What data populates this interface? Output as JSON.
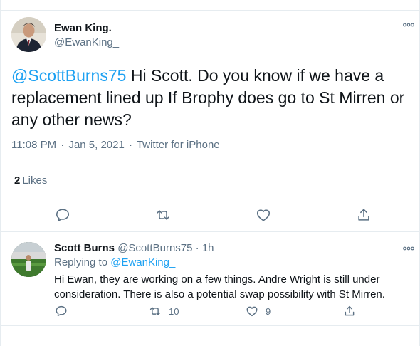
{
  "tweet": {
    "author_name": "Ewan King.",
    "author_handle": "@EwanKing_",
    "mention": "@ScottBurns75",
    "text": " Hi Scott. Do you know if we have a replacement lined up If Brophy does go to St Mirren or any other news?",
    "time": "11:08 PM",
    "date": "Jan 5, 2021",
    "source": "Twitter for iPhone",
    "likes_count": "2",
    "likes_label": "Likes",
    "separator": "·"
  },
  "reply": {
    "author_name": "Scott Burns",
    "author_handle": "@ScottBurns75",
    "separator": "·",
    "time": "1h",
    "replying_prefix": "Replying to ",
    "replying_to": "@EwanKing_",
    "text": "Hi Ewan, they are working on a few things.  Andre Wright is still under consideration.  There is also a potential swap possibility with St Mirren.",
    "retweets": "10",
    "likes": "9"
  },
  "colors": {
    "accent": "#1da1f2",
    "secondary_text": "#5b7083",
    "icon": "#5b7083",
    "divider": "#e6ecf0"
  },
  "icons": {
    "more": "more-horizontal-icon",
    "reply": "speech-bubble-icon",
    "retweet": "retweet-icon",
    "like": "heart-icon",
    "share": "share-icon"
  }
}
